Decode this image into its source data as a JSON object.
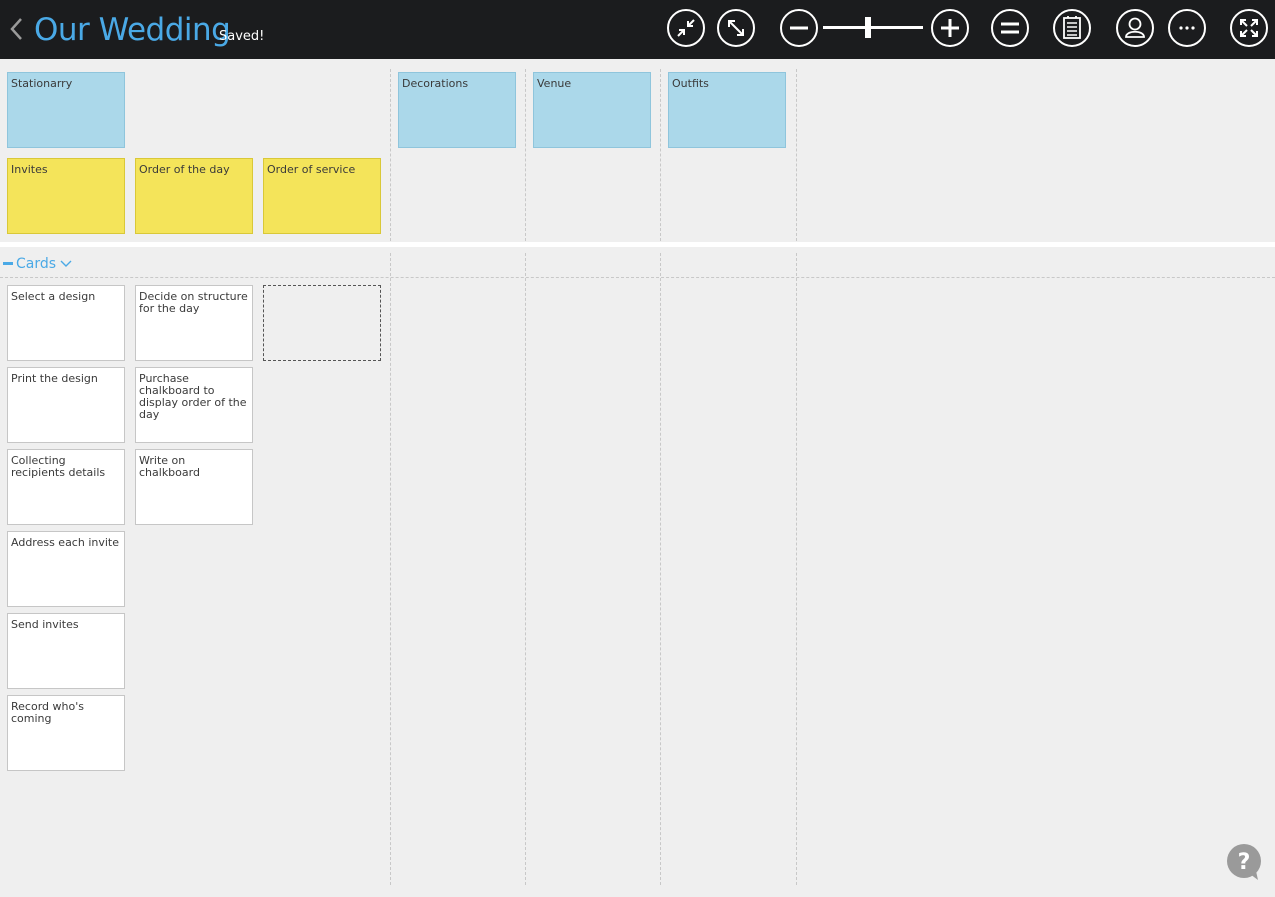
{
  "header": {
    "title": "Our Wedding",
    "status": "Saved!",
    "toolbar": [
      {
        "name": "collapse-icon"
      },
      {
        "name": "expand-icon"
      },
      {
        "name": "zoom-out-icon"
      },
      {
        "name": "zoom-in-icon"
      },
      {
        "name": "fit-icon"
      },
      {
        "name": "list-icon"
      },
      {
        "name": "user-icon"
      },
      {
        "name": "more-icon"
      },
      {
        "name": "fullscreen-icon"
      }
    ],
    "zoom_level": 0.45
  },
  "board": {
    "groups": [
      {
        "label": "Stationarry",
        "color": "#abd8ea"
      },
      {
        "label": "Decorations",
        "color": "#abd8ea"
      },
      {
        "label": "Venue",
        "color": "#abd8ea"
      },
      {
        "label": "Outfits",
        "color": "#abd8ea"
      }
    ],
    "activities": [
      {
        "label": "Invites",
        "color": "#f4e45a"
      },
      {
        "label": "Order of the day",
        "color": "#f4e45a"
      },
      {
        "label": "Order of service",
        "color": "#f4e45a"
      }
    ],
    "lane": {
      "label": "Cards"
    },
    "cards_col1": [
      "Select a design",
      "Print the design",
      "Collecting recipients details",
      "Address each invite",
      "Send invites",
      "Record who's coming"
    ],
    "cards_col2": [
      "Decide on structure for the day",
      "Purchase chalkboard to display order of the day",
      "Write on chalkboard"
    ]
  },
  "colors": {
    "topbar": "#1b1c1e",
    "accent": "#4aa9e6",
    "group_card": "#abd8ea",
    "activity_card": "#f4e45a",
    "task_card": "#ffffff",
    "help_button": "#9a9a9a"
  }
}
